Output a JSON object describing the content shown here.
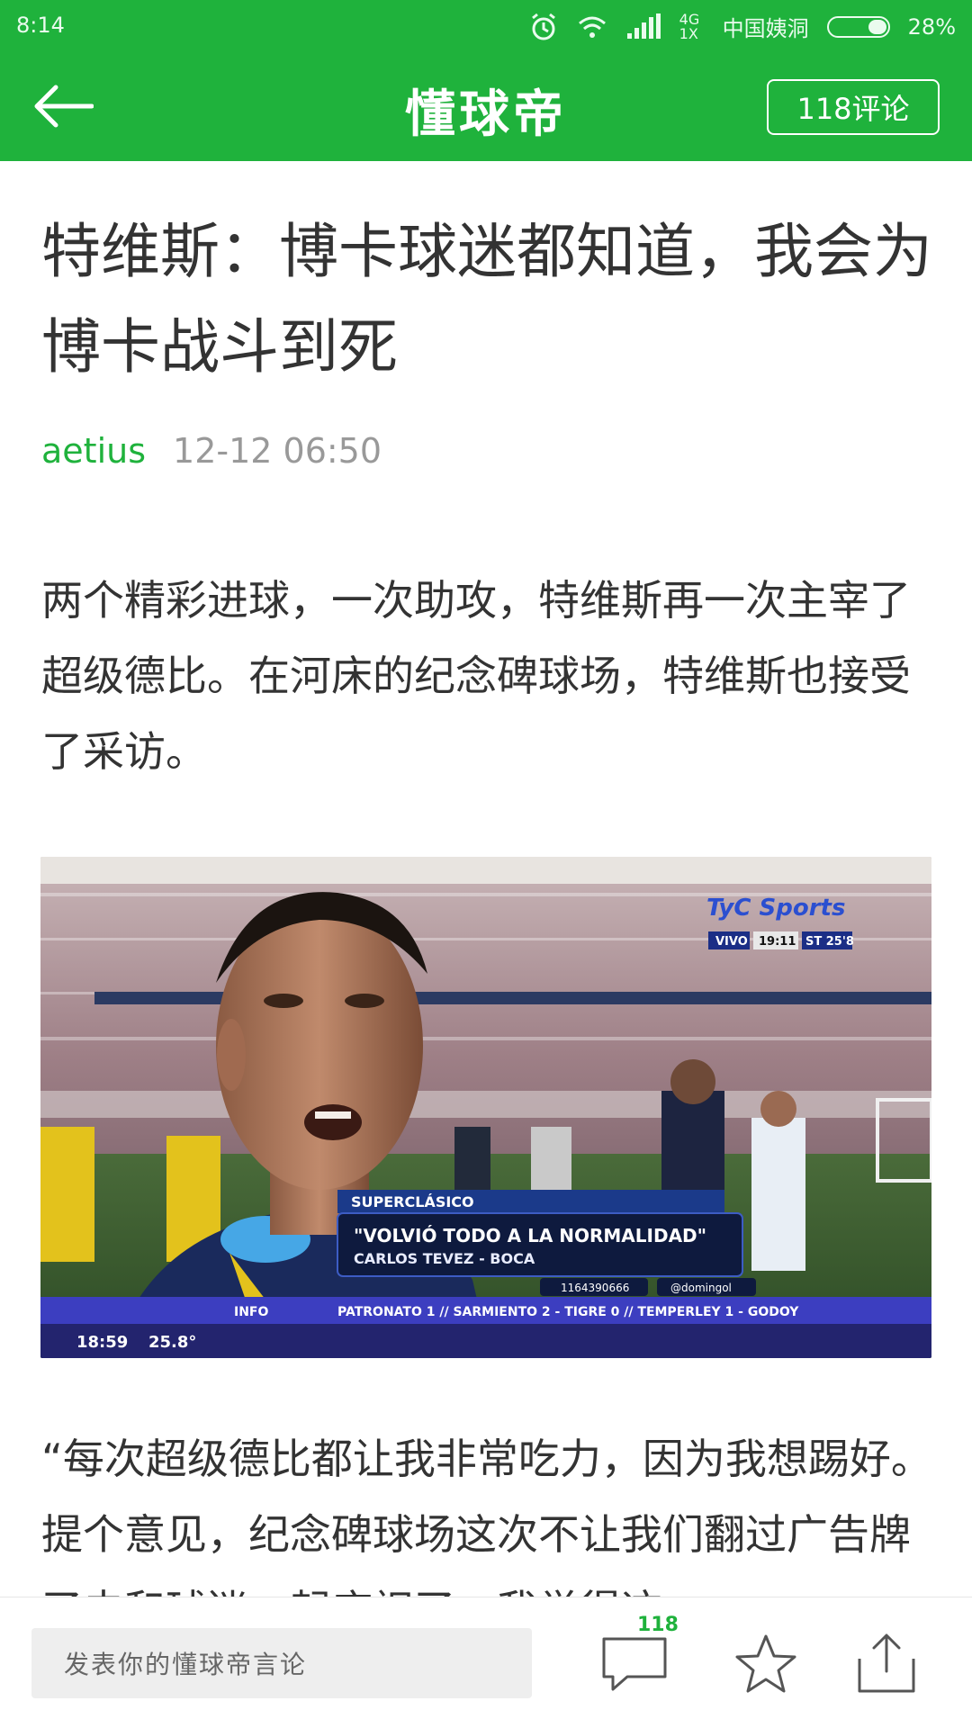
{
  "status_bar": {
    "time": "8:14",
    "network_label": "4G 1X",
    "carrier": "中国姨洞",
    "battery": "28%"
  },
  "nav": {
    "back_icon": "arrow-left-icon",
    "brand": "懂球帝",
    "comments_button": "118评论"
  },
  "article": {
    "title": "特维斯：博卡球迷都知道，我会为博卡战斗到死",
    "author": "aetius",
    "timestamp": "12-12 06:50",
    "paragraph1": "两个精彩进球，一次助攻，特维斯再一次主宰了超级德比。在河床的纪念碑球场，特维斯也接受了采访。",
    "paragraph2": "“每次超级德比都让我非常吃力，因为我想踢好。提个意见，纪念碑球场这次不让我们翻过广告牌了去和球迷一起庆祝了，我觉得这"
  },
  "photo": {
    "overlay_title": "SUPERCLÁSICO",
    "overlay_quote": "\"VOLVIÓ TODO A LA NORMALIDAD\"",
    "overlay_sub": "CARLOS TEVEZ - BOCA",
    "overlay_phone": "1164390666",
    "overlay_twitter": "@domingol",
    "ticker_label": "INFO",
    "ticker": "PATRONATO 1 // SARMIENTO 2 - TIGRE 0 // TEMPERLEY 1 - GODOY",
    "clock": "18:59",
    "temp": "25.8°",
    "broadcaster": "TyC Sports",
    "live_label": "VIVO",
    "live_time": "19:11",
    "live_period": "ST 25'8"
  },
  "bottom_bar": {
    "comment_placeholder": "发表你的懂球帝言论",
    "comment_count": "118",
    "comment_icon": "speech-bubble-icon",
    "favorite_icon": "star-icon",
    "share_icon": "share-icon"
  },
  "colors": {
    "brand_green": "#1fb23c",
    "text": "#333333",
    "meta_gray": "#999999"
  }
}
